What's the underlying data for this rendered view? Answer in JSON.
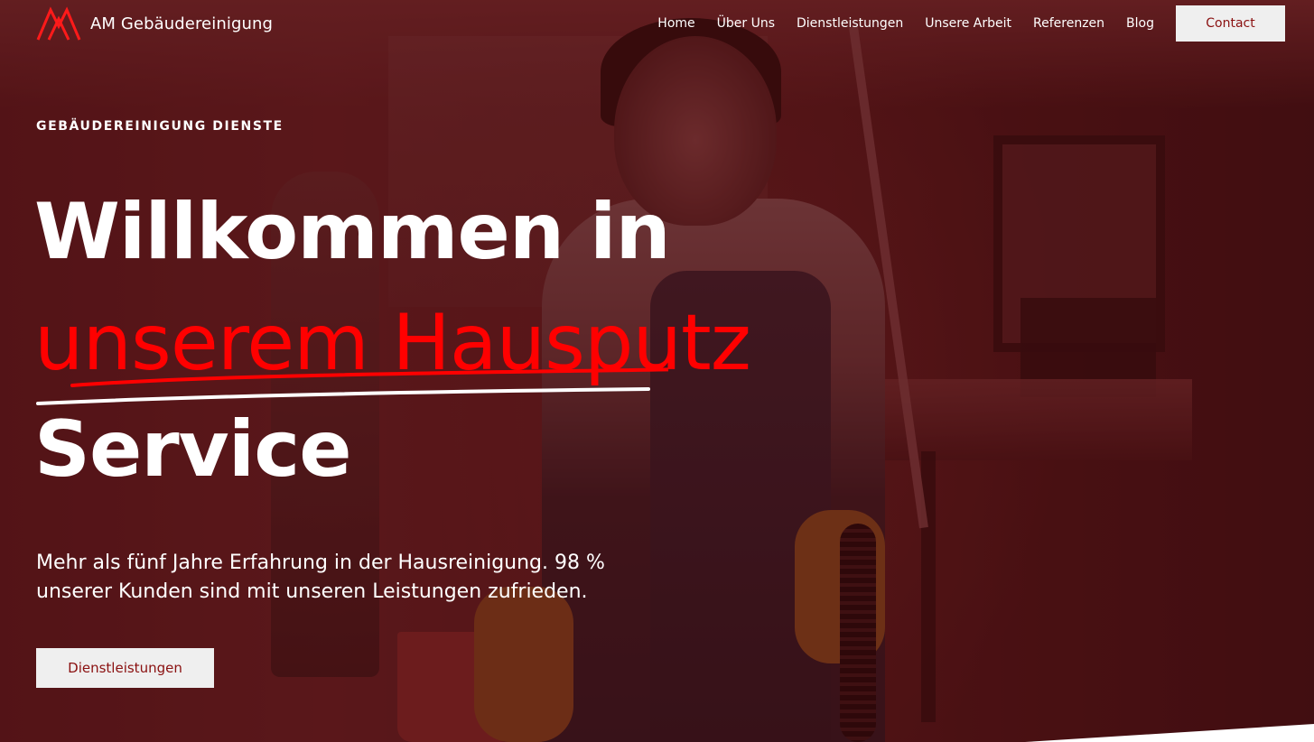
{
  "header": {
    "brand": "AM Gebäudereinigung",
    "nav": [
      "Home",
      "Über Uns",
      "Dienstleistungen",
      "Unsere Arbeit",
      "Referenzen",
      "Blog"
    ],
    "contact_label": "Contact"
  },
  "hero": {
    "eyebrow": "GEBÄUDEREINIGUNG DIENSTE",
    "title_line1": "Willkommen in",
    "title_line2": "unserem Hausputz",
    "title_line3": "Service",
    "lead": "Mehr als fünf Jahre Erfahrung in der Hausreinigung. 98 % unserer Kunden sind mit unseren Leistungen zufrieden.",
    "cta_label": "Dienstleistungen"
  },
  "colors": {
    "accent": "#ff0000",
    "button_bg": "#efefef",
    "button_text": "#8a1010"
  }
}
